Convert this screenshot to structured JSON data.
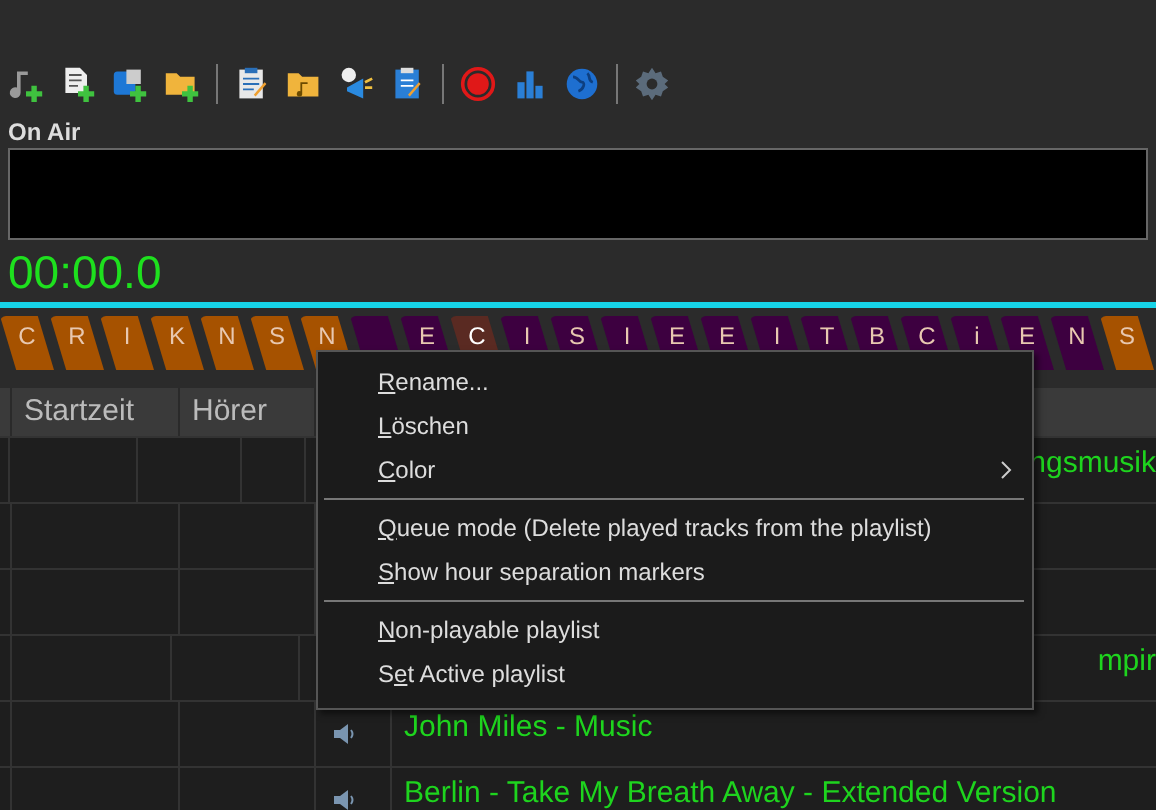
{
  "on_air": {
    "label": "On Air",
    "timer": "00:00.0"
  },
  "tabs": [
    {
      "label": "C",
      "color": "#a65200",
      "selected": false
    },
    {
      "label": "R",
      "color": "#a65200",
      "selected": false
    },
    {
      "label": "I",
      "color": "#a65200",
      "selected": false
    },
    {
      "label": "K",
      "color": "#a65200",
      "selected": false
    },
    {
      "label": "N",
      "color": "#a65200",
      "selected": false
    },
    {
      "label": "S",
      "color": "#a65200",
      "selected": false
    },
    {
      "label": "N",
      "color": "#a65200",
      "selected": false
    },
    {
      "color": "#3d0040"
    },
    {
      "label": "E",
      "color": "#3d0040",
      "selected": false
    },
    {
      "label": "C",
      "color": "#5a2a22",
      "selected": true
    },
    {
      "label": "I",
      "color": "#3d0040",
      "selected": false
    },
    {
      "label": "S",
      "color": "#3d0040",
      "selected": false
    },
    {
      "label": "I",
      "color": "#3d0040",
      "selected": false
    },
    {
      "label": "E",
      "color": "#3d0040",
      "selected": false
    },
    {
      "label": "E",
      "color": "#3d0040",
      "selected": false
    },
    {
      "label": "I",
      "color": "#3d0040",
      "selected": false
    },
    {
      "label": "T",
      "color": "#3d0040",
      "selected": false
    },
    {
      "label": "B",
      "color": "#3d0040",
      "selected": false
    },
    {
      "label": "C",
      "color": "#3d0040",
      "selected": false
    },
    {
      "label": "i",
      "color": "#3d0040",
      "selected": false
    },
    {
      "label": "E",
      "color": "#3d0040",
      "selected": false
    },
    {
      "label": "N",
      "color": "#3d0040",
      "selected": false
    },
    {
      "label": "S",
      "color": "#a65200",
      "selected": false
    }
  ],
  "table": {
    "columns": [
      "Startzeit",
      "Hörer"
    ],
    "rows": [
      {
        "title": "ngsmusik",
        "covered": true
      },
      {},
      {},
      {
        "title": "mpir",
        "covered": true
      },
      {
        "title": "John Miles - Music",
        "covered": false
      },
      {
        "title": "Berlin - Take My Breath Away - Extended Version",
        "covered": false
      }
    ]
  },
  "context_menu": {
    "groups": [
      [
        {
          "key": "R",
          "rest": "ename..."
        },
        {
          "key": "L",
          "rest": "öschen"
        },
        {
          "key": "C",
          "rest": "olor",
          "submenu": true
        }
      ],
      [
        {
          "key": "Q",
          "rest": "ueue mode (Delete played tracks from the playlist)"
        },
        {
          "key": "S",
          "rest": "how hour separation markers"
        }
      ],
      [
        {
          "key": "N",
          "rest": "on-playable playlist"
        },
        {
          "before": "S",
          "key": "e",
          "rest": "t Active playlist"
        }
      ]
    ]
  }
}
